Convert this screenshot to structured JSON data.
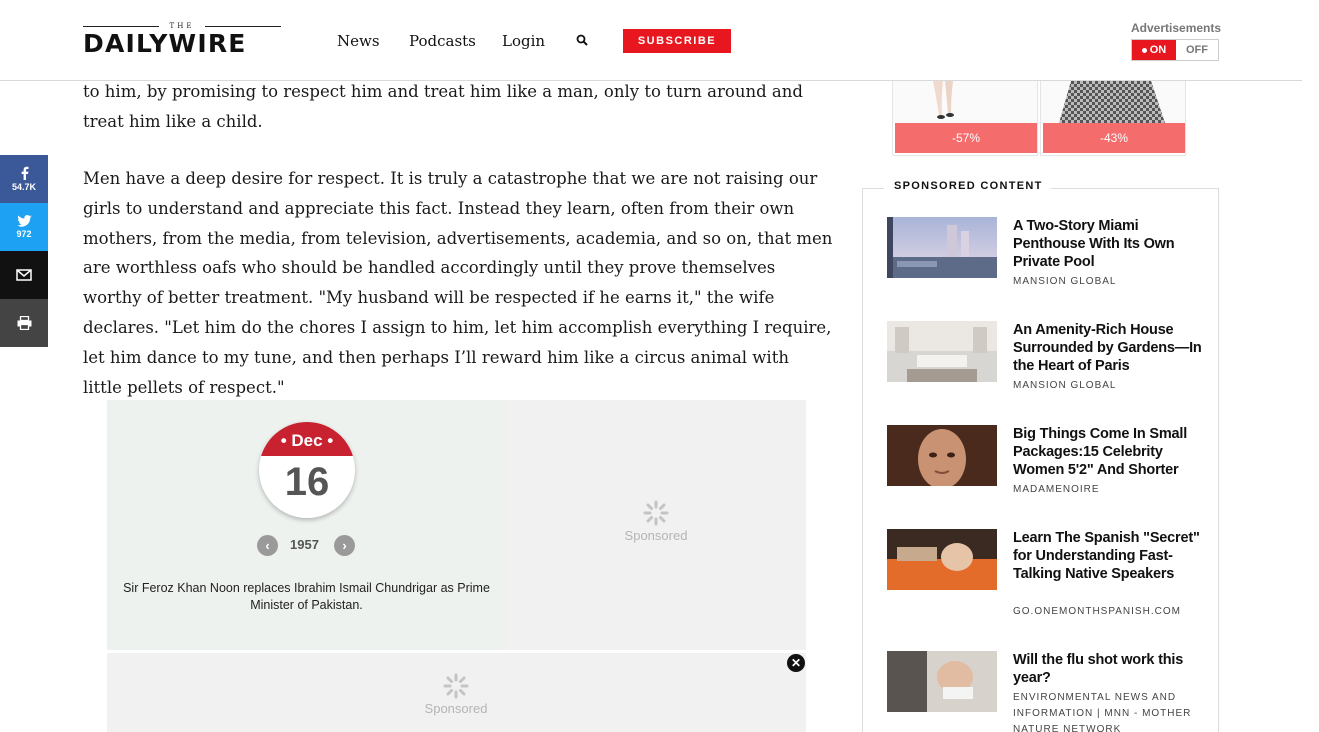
{
  "header": {
    "logo_small": "THE",
    "logo_text": "DAILYWIRE",
    "nav": [
      "News",
      "Podcasts",
      "Login"
    ],
    "subscribe_label": "SUBSCRIBE",
    "ads_label": "Advertisements",
    "ads_on": "ON",
    "ads_off": "OFF"
  },
  "share": {
    "facebook_count": "54.7K",
    "twitter_count": "972"
  },
  "article": {
    "paragraphs": [
      "to him, by promising to respect him and treat him like a man, only to turn around and treat him like a child.",
      "Men have a deep desire for respect. It is truly a catastrophe that we are not raising our girls to understand and appreciate this fact. Instead they learn, often from their own mothers, from the media, from television, advertisements, academia, and so on, that men are worthless oafs who should be handled accordingly until they prove themselves worthy of better treatment. \"My husband will be respected if he earns it,\" the wife declares. \"Let him do the chores I assign to him, let him accomplish everything I require, let him dance to my tune, and then perhaps I’ll reward him like a circus animal with little pellets of respect.\""
    ]
  },
  "widget": {
    "month": "• Dec •",
    "day": "16",
    "year": "1957",
    "event": "Sir Feroz Khan Noon replaces Ibrahim Ismail Chundrigar as Prime Minister of Pakistan.",
    "sponsored_label": "Sponsored",
    "sponsored_label_2": "Sponsored",
    "close_glyph": "✕"
  },
  "product_ad": {
    "discounts": [
      "-57%",
      "-43%"
    ]
  },
  "sponsored": {
    "title": "SPONSORED CONTENT",
    "items": [
      {
        "headline": "A Two-Story Miami Penthouse With Its Own Private Pool",
        "source": "MANSION GLOBAL"
      },
      {
        "headline": "An Amenity-Rich House Surrounded by Gardens—In the Heart of Paris",
        "source": "MANSION GLOBAL"
      },
      {
        "headline": "Big Things Come In Small Packages:15 Celebrity Women 5'2\" And Shorter",
        "source": "MADAMENOIRE"
      },
      {
        "headline": "Learn The Spanish \"Secret\" for Understanding Fast-Talking Native Speakers",
        "source": "GO.ONEMONTHSPANISH.COM"
      },
      {
        "headline": "Will the flu shot work this year?",
        "source": "ENVIRONMENTAL NEWS AND INFORMATION | MNN - MOTHER NATURE NETWORK"
      }
    ]
  },
  "colors": {
    "brand_red": "#e8171f",
    "facebook": "#3b5998",
    "twitter": "#1da1f2",
    "email": "#111111",
    "print": "#444444"
  }
}
